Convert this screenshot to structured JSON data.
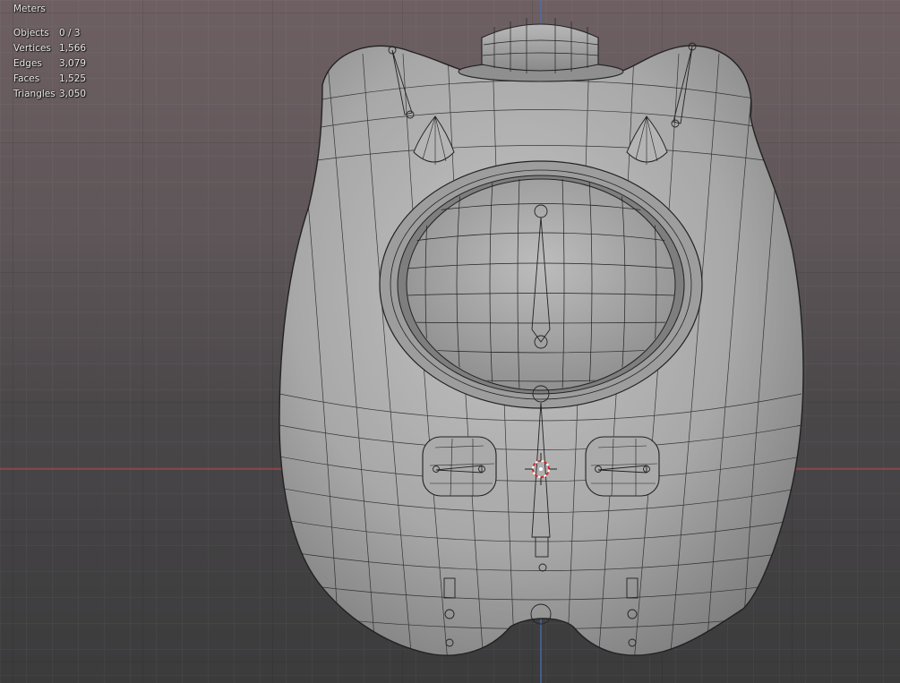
{
  "viewport": {
    "units_label": "Meters",
    "stats": [
      {
        "key": "Objects",
        "value": "0 / 3"
      },
      {
        "key": "Vertices",
        "value": "1,566"
      },
      {
        "key": "Edges",
        "value": "3,079"
      },
      {
        "key": "Faces",
        "value": "1,525"
      },
      {
        "key": "Triangles",
        "value": "3,050"
      }
    ]
  },
  "colors": {
    "x_axis": "#b04446",
    "y_axis": "#4a6fb0",
    "mesh_fill": "#a9a9a9",
    "wire": "#1e1e1e"
  }
}
